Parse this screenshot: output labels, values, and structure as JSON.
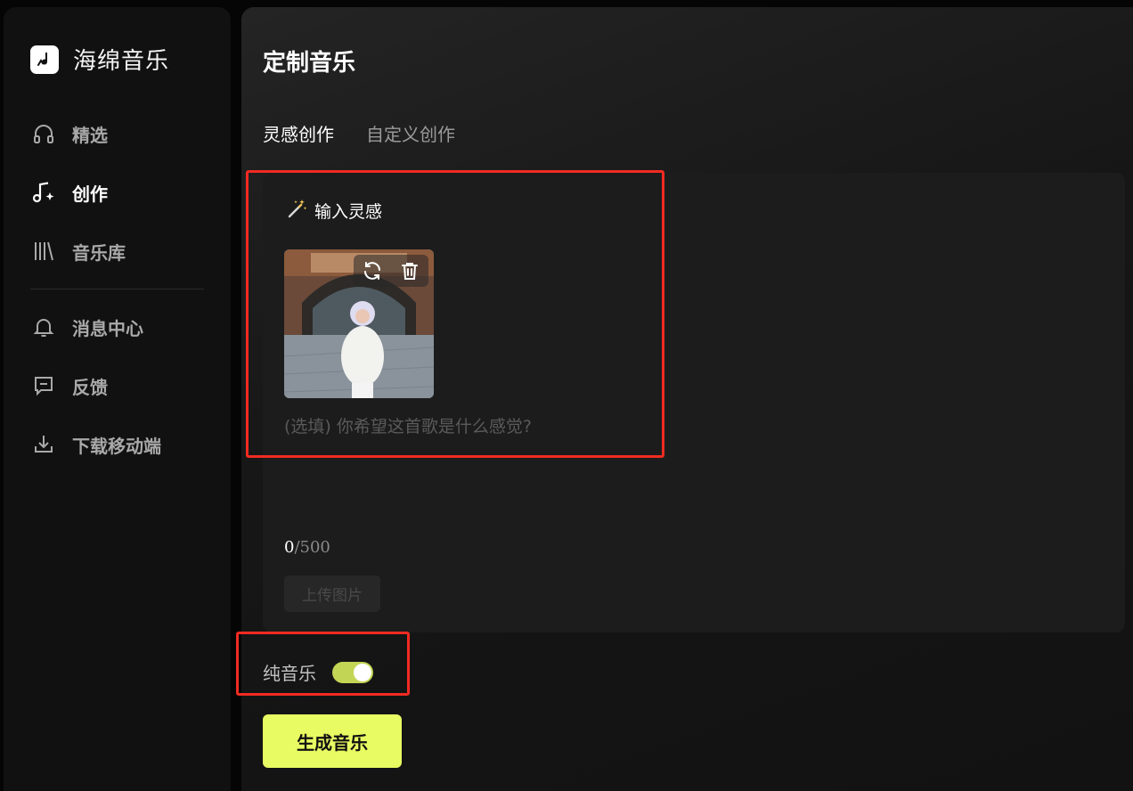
{
  "app": {
    "name": "海绵音乐",
    "logo_icon": "music-note-logo"
  },
  "sidebar": {
    "items": [
      {
        "label": "精选",
        "icon": "headphones-icon",
        "active": false
      },
      {
        "label": "创作",
        "icon": "music-sparkle-icon",
        "active": true
      },
      {
        "label": "音乐库",
        "icon": "library-icon",
        "active": false
      }
    ],
    "secondary_items": [
      {
        "label": "消息中心",
        "icon": "bell-icon"
      },
      {
        "label": "反馈",
        "icon": "feedback-icon"
      },
      {
        "label": "下载移动端",
        "icon": "download-icon"
      }
    ]
  },
  "main": {
    "title": "定制音乐",
    "tabs": [
      {
        "label": "灵感创作",
        "active": true
      },
      {
        "label": "自定义创作",
        "active": false
      }
    ],
    "input_card": {
      "icon": "magic-wand-icon",
      "title": "输入灵感",
      "image_actions": [
        "refresh-icon",
        "trash-icon"
      ],
      "prompt_placeholder": "(选填) 你希望这首歌是什么感觉?",
      "prompt_value": "",
      "char_count": "0",
      "char_max": "/500",
      "upload_label": "上传图片"
    },
    "instrumental": {
      "label": "纯音乐",
      "enabled": true
    },
    "generate_label": "生成音乐"
  },
  "colors": {
    "accent": "#e8fb62",
    "toggle_on": "#c3d555",
    "highlight": "#f22b22",
    "background": "#050505"
  }
}
